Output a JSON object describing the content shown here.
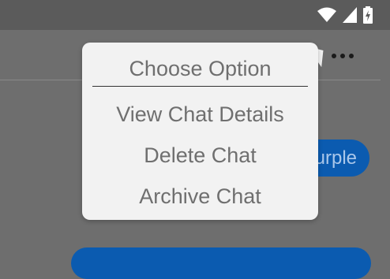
{
  "status_bar": {
    "icons": [
      "wifi-icon",
      "signal-icon",
      "battery-charging-icon"
    ]
  },
  "toolbar": {
    "more_icon": "more-horizontal-icon"
  },
  "chat": {
    "bubble_text": "urple",
    "bubble_color": "#0b5bb0"
  },
  "popup": {
    "title": "Choose Option",
    "options": [
      {
        "label": "View Chat Details"
      },
      {
        "label": "Delete Chat"
      },
      {
        "label": "Archive Chat"
      }
    ]
  }
}
